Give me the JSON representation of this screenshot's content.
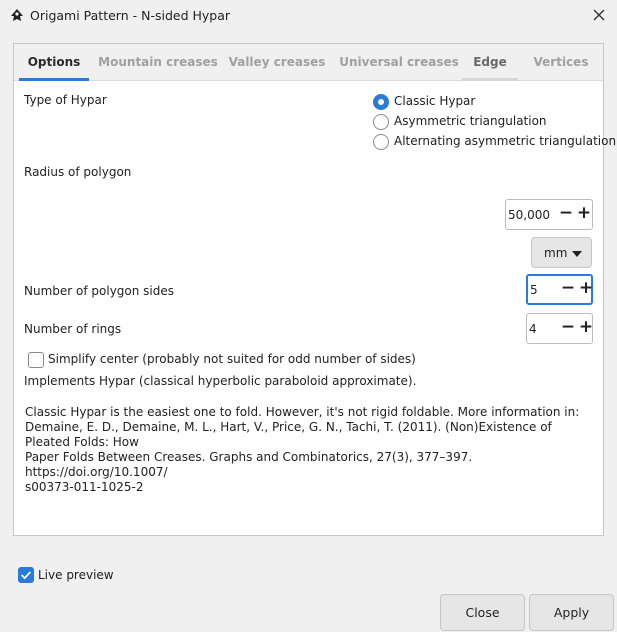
{
  "window": {
    "title": "Origami Pattern - N-sided Hypar",
    "app_icon": "inkscape-logo-icon",
    "close_icon": "close-icon"
  },
  "tabs": [
    {
      "label": "Options",
      "active": true
    },
    {
      "label": "Mountain creases",
      "active": false
    },
    {
      "label": "Valley creases",
      "active": false
    },
    {
      "label": "Universal creases",
      "active": false
    },
    {
      "label": "Edge",
      "active": false
    },
    {
      "label": "Vertices",
      "active": false
    }
  ],
  "options": {
    "type_label": "Type of Hypar",
    "type_choices": [
      {
        "label": "Classic Hypar",
        "checked": true
      },
      {
        "label": "Asymmetric triangulation",
        "checked": false
      },
      {
        "label": "Alternating asymmetric triangulation",
        "checked": false
      }
    ],
    "radius_label": "Radius of polygon",
    "radius_value": "50,000",
    "unit_value": "mm",
    "sides_label": "Number of polygon sides",
    "sides_value": "5",
    "rings_label": "Number of rings",
    "rings_value": "4",
    "minus": "−",
    "plus": "+",
    "simplify_label": "Simplify center (probably not suited for odd number of sides)",
    "simplify_checked": false,
    "implements_text": "Implements Hypar (classical hyperbolic paraboloid approximate).",
    "info_lines": [
      "Classic Hypar is the easiest one to fold. However, it's not rigid foldable. More information in:",
      "Demaine, E. D., Demaine, M. L., Hart, V., Price, G. N.,  Tachi, T. (2011). (Non)Existence of Pleated Folds: How",
      "Paper Folds Between Creases. Graphs and Combinatorics, 27(3), 377–397. https://doi.org/10.1007/",
      "s00373-011-1025-2"
    ]
  },
  "live_preview": {
    "label": "Live preview",
    "checked": true
  },
  "buttons": {
    "close": "Close",
    "apply": "Apply"
  },
  "colors": {
    "accent": "#2a7ad8"
  }
}
